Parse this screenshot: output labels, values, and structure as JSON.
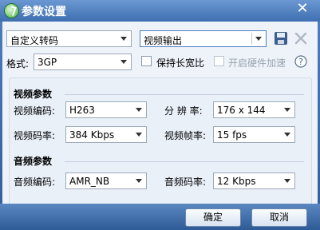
{
  "window": {
    "title": "参数设置"
  },
  "top": {
    "preset_category": "自定义转码",
    "preset_name": "视频输出",
    "format_label": "格式:",
    "format_value": "3GP",
    "keep_aspect_label": "保持长宽比",
    "keep_aspect_checked": false,
    "hw_accel_label": "开启硬件加速",
    "hw_accel_checked": false,
    "hw_accel_enabled": false
  },
  "video": {
    "title": "视频参数",
    "codec_label": "视频编码:",
    "codec_value": "H263",
    "resolution_label": "分 辨 率:",
    "resolution_value": "176 x 144",
    "bitrate_label": "视频码率:",
    "bitrate_value": "384 Kbps",
    "framerate_label": "视频帧率:",
    "framerate_value": "15 fps"
  },
  "audio": {
    "title": "音频参数",
    "codec_label": "音频编码:",
    "codec_value": "AMR_NB",
    "bitrate_label": "音频码率:",
    "bitrate_value": "12 Kbps"
  },
  "buttons": {
    "ok": "确定",
    "cancel": "取消"
  },
  "icons": {
    "save": "save-icon",
    "delete": "delete-icon",
    "help": "help-icon"
  },
  "colors": {
    "titlebar": "#3e6fb0",
    "content_bg": "#eef3fa",
    "save_icon": "#3a5f8f"
  }
}
